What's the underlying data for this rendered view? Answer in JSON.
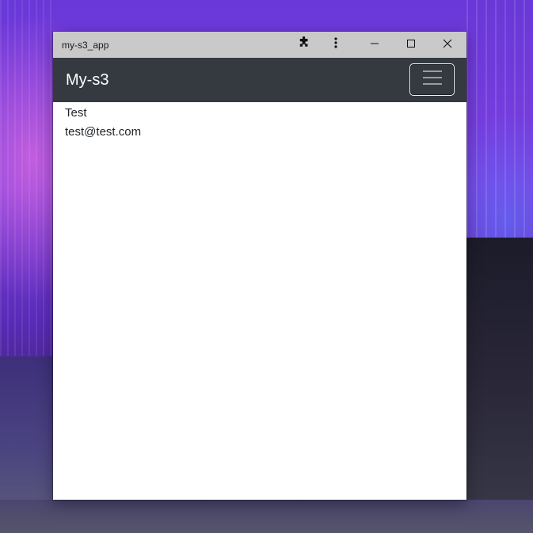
{
  "window": {
    "title": "my-s3_app"
  },
  "titlebar": {
    "icons": [
      "puzzle-extension-icon",
      "more-vertical-icon",
      "minimize-icon",
      "maximize-icon",
      "close-icon"
    ]
  },
  "navbar": {
    "brand": "My-s3",
    "background": "#343a40",
    "toggler_icon": "hamburger-menu-icon"
  },
  "content": {
    "name": "Test",
    "email": "test@test.com"
  }
}
